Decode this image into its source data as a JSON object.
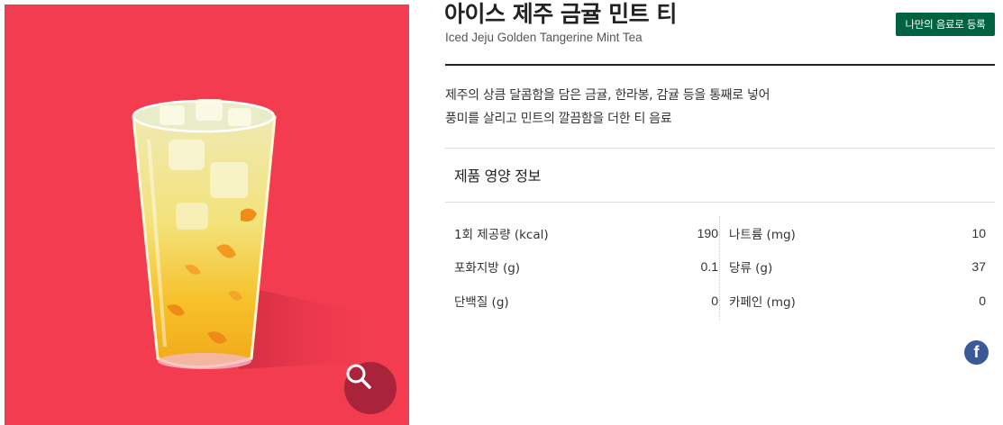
{
  "product": {
    "title": "아이스 제주 금귤 민트 티",
    "subtitle": "Iced Jeju Golden Tangerine Mint Tea",
    "description_lines": [
      "제주의 상큼 달콤함을 담은 금귤, 한라봉, 감귤 등을 통째로 넣어",
      "풍미를 살리고 민트의 깔끔함을 더한 티 음료"
    ]
  },
  "actions": {
    "my_menu_label": "나만의 음료로 등록",
    "zoom_icon": "magnifier-icon",
    "share_icon": "facebook-icon"
  },
  "nutrition": {
    "heading": "제품 영양 정보",
    "left": [
      {
        "label": "1회 제공량 (kcal)",
        "value": "190"
      },
      {
        "label": "포화지방 (g)",
        "value": "0.1"
      },
      {
        "label": "단백질 (g)",
        "value": "0"
      }
    ],
    "right": [
      {
        "label": "나트륨 (mg)",
        "value": "10"
      },
      {
        "label": "당류 (g)",
        "value": "37"
      },
      {
        "label": "카페인 (mg)",
        "value": "0"
      }
    ]
  },
  "colors": {
    "photo_background": "#f33c50",
    "brand_green": "#006241",
    "zoom_button": "#a9243a",
    "facebook_blue": "#3b5998"
  }
}
